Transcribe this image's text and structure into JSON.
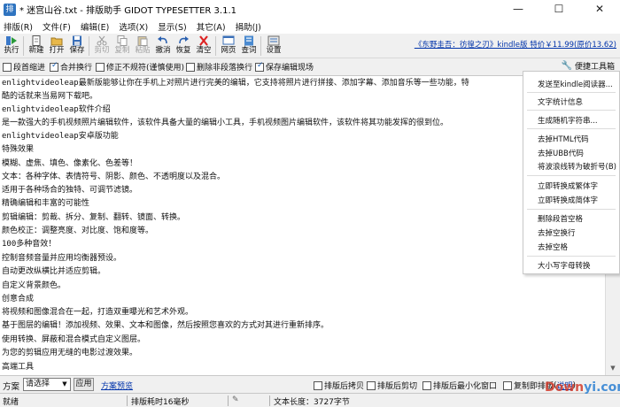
{
  "window": {
    "title": "* 迷宫山谷.txt - 排版助手 GIDOT TYPESETTER 3.1.1",
    "minimize": "—",
    "maximize": "☐",
    "close": "✕"
  },
  "menu": [
    "排版(R)",
    "文件(F)",
    "编辑(E)",
    "选项(X)",
    "显示(S)",
    "其它(A)",
    "捐助(J)"
  ],
  "toolbar": {
    "buttons": [
      {
        "label": "执行",
        "icon": "execute-icon",
        "enabled": true
      },
      {
        "label": "新建",
        "icon": "new-file-icon",
        "enabled": true
      },
      {
        "label": "打开",
        "icon": "open-folder-icon",
        "enabled": true
      },
      {
        "label": "保存",
        "icon": "save-icon",
        "enabled": true
      },
      {
        "label": "剪切",
        "icon": "cut-icon",
        "enabled": false
      },
      {
        "label": "复制",
        "icon": "copy-icon",
        "enabled": false
      },
      {
        "label": "粘贴",
        "icon": "paste-icon",
        "enabled": false
      },
      {
        "label": "撤消",
        "icon": "undo-icon",
        "enabled": true
      },
      {
        "label": "恢复",
        "icon": "redo-icon",
        "enabled": true
      },
      {
        "label": "清空",
        "icon": "clear-icon",
        "enabled": true
      },
      {
        "label": "网页",
        "icon": "webpage-icon",
        "enabled": true
      },
      {
        "label": "查词",
        "icon": "lookup-icon",
        "enabled": true
      },
      {
        "label": "设置",
        "icon": "settings-icon",
        "enabled": true
      }
    ],
    "promo_link": "《东野圭吾：彷徨之刃》kindle版 特价￥11.99(原价13.62)"
  },
  "options": {
    "items": [
      {
        "label": "段首缩进",
        "checked": false
      },
      {
        "label": "合并换行",
        "checked": true
      },
      {
        "label": "修正不规符(谨慎使用)",
        "checked": false
      },
      {
        "label": "删除非段落换行",
        "checked": false
      },
      {
        "label": "保存编辑现场",
        "checked": true
      }
    ],
    "toolbox_label": "便捷工具箱"
  },
  "editor": {
    "lines": [
      "enlightvideoleap最新版能够让你在手机上对照片进行完美的编辑，它支持将照片进行拼接、添加字幕、添加音乐等一些功能，特",
      "酷的话就来当易网下载吧。",
      "enlightvideoleap软件介绍",
      "是一款强大的手机视频照片编辑软件，该软件具备大量的编辑小工具，手机视频图片编辑软件，该软件将其功能发挥的很到位。",
      "enlightvideoleap安卓版功能",
      "特殊效果",
      "模糊、虚焦、填色、像素化、色差等！",
      "文本：各种字体、表情符号、阴影、颜色、不透明度以及混合。",
      "适用于各种场合的独特、可调节滤镜。",
      "精确编辑和丰富的可能性",
      "剪辑编辑：剪裁、拆分、复制、翻转、镜面、转换。",
      "颜色校正：调整亮度、对比度、饱和度等。",
      "100多种音效！",
      "控制音频音量并应用均衡器预设。",
      "自动更改纵横比并适应剪辑。",
      "自定义背景颜色。",
      "创意合成",
      "将视频和图像混合在一起，打造双重曝光和艺术外观。",
      "基于图层的编辑！添加视频、效果、文本和图像，然后按照您喜欢的方式对其进行重新排序。",
      "使用转换、屏蔽和混合模式自定义图层。",
      "为您的剪辑应用无缝的电影过渡效果。",
      "高端工具"
    ]
  },
  "dropdown": {
    "groups": [
      [
        "发送至kindle阅读器..."
      ],
      [
        "文字统计信息"
      ],
      [
        "生成随机字符串..."
      ],
      [
        "去掉HTML代码",
        "去掉UBB代码",
        "将波浪线转为破折号(B)"
      ],
      [
        "立即转换成繁体字",
        "立即转换成简体字"
      ],
      [
        "删除段首空格",
        "去掉空换行",
        "去掉空格"
      ],
      [
        "大小写字母转换"
      ]
    ]
  },
  "bottom": {
    "scheme_label": "方案",
    "scheme_select": "请选择",
    "apply_label": "应用",
    "preview_label": "方案预览",
    "options": [
      {
        "label": "排版后拷贝",
        "checked": false
      },
      {
        "label": "排版后剪切",
        "checked": false
      },
      {
        "label": "排版后最小化窗口",
        "checked": false
      },
      {
        "label": "复制即排版",
        "checked": false
      }
    ],
    "help_label": "说明"
  },
  "status": {
    "ready": "就绪",
    "elapsed": "排版耗时16毫秒",
    "length": "文本长度：3727字节"
  },
  "watermark": {
    "part1": "Down",
    "part2": "yi.com"
  }
}
